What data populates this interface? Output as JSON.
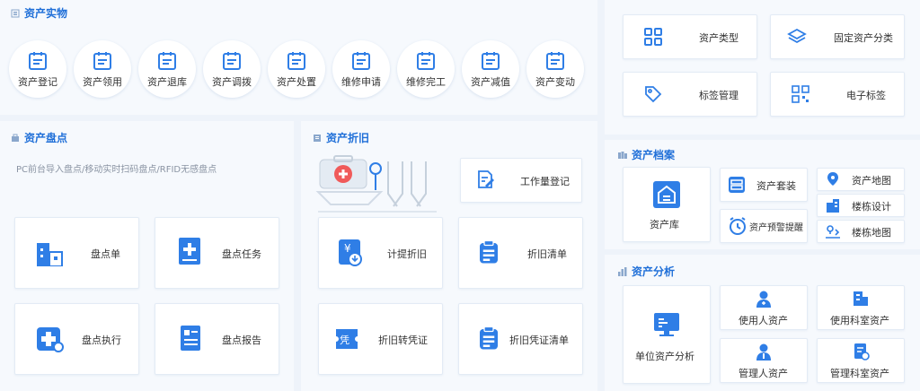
{
  "colors": {
    "accent": "#2f7ee6",
    "title": "#1f6fd8",
    "panel": "#f6f9fd",
    "bg": "#eef3fa"
  },
  "entity": {
    "title": "资产实物",
    "items": [
      {
        "label": "资产登记",
        "icon": "form-icon"
      },
      {
        "label": "资产领用",
        "icon": "form-icon"
      },
      {
        "label": "资产退库",
        "icon": "form-icon"
      },
      {
        "label": "资产调拨",
        "icon": "form-icon"
      },
      {
        "label": "资产处置",
        "icon": "form-icon"
      },
      {
        "label": "维修申请",
        "icon": "form-icon"
      },
      {
        "label": "维修完工",
        "icon": "form-icon"
      },
      {
        "label": "资产减值",
        "icon": "form-icon"
      },
      {
        "label": "资产变动",
        "icon": "form-icon"
      }
    ]
  },
  "config": {
    "items": [
      {
        "label": "资产类型",
        "icon": "grid-icon"
      },
      {
        "label": "固定资产分类",
        "icon": "layers-icon"
      },
      {
        "label": "标签管理",
        "icon": "tag-icon"
      },
      {
        "label": "电子标签",
        "icon": "qrcode-icon"
      }
    ]
  },
  "inventory": {
    "title": "资产盘点",
    "subtitle": "PC前台导入盘点/移动实时扫码盘点/RFID无感盘点",
    "items": [
      {
        "label": "盘点单",
        "icon": "building-icon"
      },
      {
        "label": "盘点任务",
        "icon": "notebook-plus-icon"
      },
      {
        "label": "盘点执行",
        "icon": "medical-wrench-icon"
      },
      {
        "label": "盘点报告",
        "icon": "report-icon"
      }
    ]
  },
  "depreciation": {
    "title": "资产折旧",
    "top_item": {
      "label": "工作量登记",
      "icon": "edit-doc-icon"
    },
    "illustration": "medical-kit-illustration",
    "items": [
      {
        "label": "计提折旧",
        "icon": "yen-notebook-icon"
      },
      {
        "label": "折旧清单",
        "icon": "clipboard-icon"
      },
      {
        "label": "折旧转凭证",
        "icon": "voucher-icon"
      },
      {
        "label": "折旧凭证清单",
        "icon": "clipboard-icon"
      }
    ]
  },
  "archive": {
    "title": "资产档案",
    "main": {
      "label": "资产库",
      "icon": "warehouse-icon"
    },
    "items": [
      {
        "label": "资产套装",
        "icon": "box-icon"
      },
      {
        "label": "资产预警提醒",
        "icon": "alarm-icon"
      },
      {
        "label": "资产地图",
        "icon": "map-icon"
      },
      {
        "label": "楼栋设计",
        "icon": "building-icon"
      },
      {
        "label": "楼栋地图",
        "icon": "map-pin-icon"
      }
    ]
  },
  "analysis": {
    "title": "资产分析",
    "main": {
      "label": "单位资产分析",
      "icon": "monitor-icon"
    },
    "items": [
      {
        "label": "使用人资产",
        "icon": "doctor-icon"
      },
      {
        "label": "使用科室资产",
        "icon": "department-icon"
      },
      {
        "label": "管理人资产",
        "icon": "manager-icon"
      },
      {
        "label": "管理科室资产",
        "icon": "doc-gear-icon"
      }
    ]
  }
}
